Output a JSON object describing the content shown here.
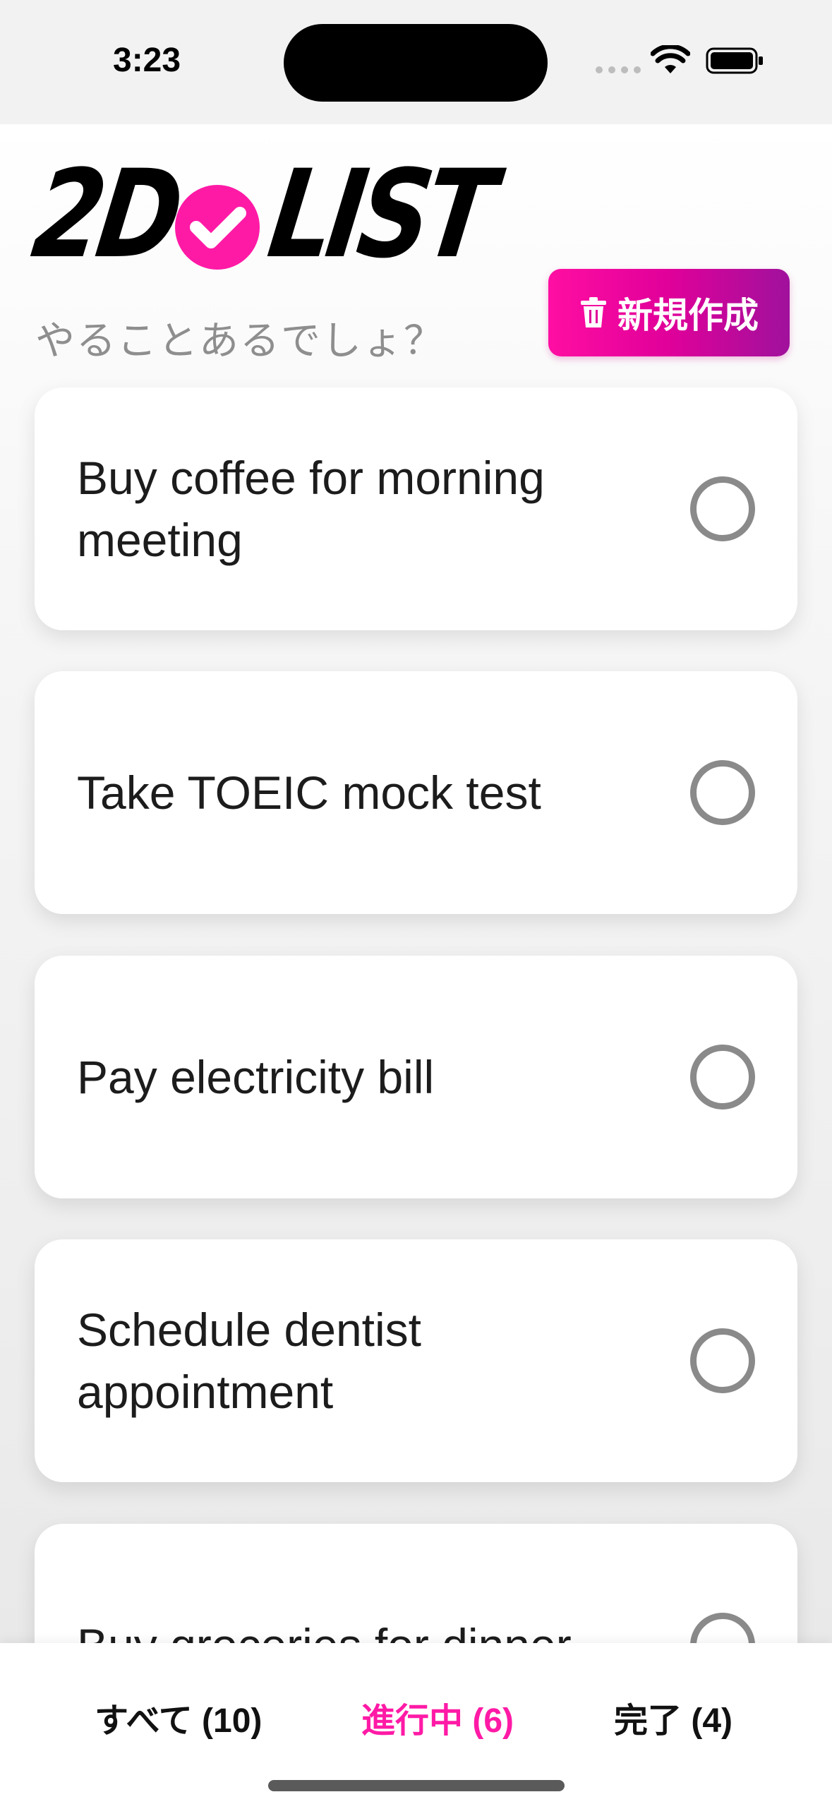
{
  "status_bar": {
    "time": "3:23",
    "icons": [
      "signal-dots-icon",
      "wifi-icon",
      "battery-icon"
    ]
  },
  "header": {
    "logo": {
      "left": "2D",
      "right": "LIST",
      "icon": "check-circle-icon",
      "accent_color": "#ff1aa6"
    },
    "tagline": "やることあるでしょ？",
    "new_button": {
      "label": "新規作成",
      "icon": "trash-icon",
      "gradient": [
        "#ff0ea2",
        "#a0119c"
      ]
    }
  },
  "tasks": [
    {
      "title": "Buy coffee for morning meeting",
      "completed": false
    },
    {
      "title": "Take TOEIC mock test",
      "completed": false
    },
    {
      "title": "Pay electricity bill",
      "completed": false
    },
    {
      "title": "Schedule dentist appointment",
      "completed": false
    },
    {
      "title": "Buy groceries for dinner",
      "completed": false
    }
  ],
  "filters": {
    "all": "すべて (10)",
    "in_progress": "進行中 (6)",
    "done": "完了 (4)",
    "active": "in_progress",
    "active_color": "#ff1aa6"
  }
}
